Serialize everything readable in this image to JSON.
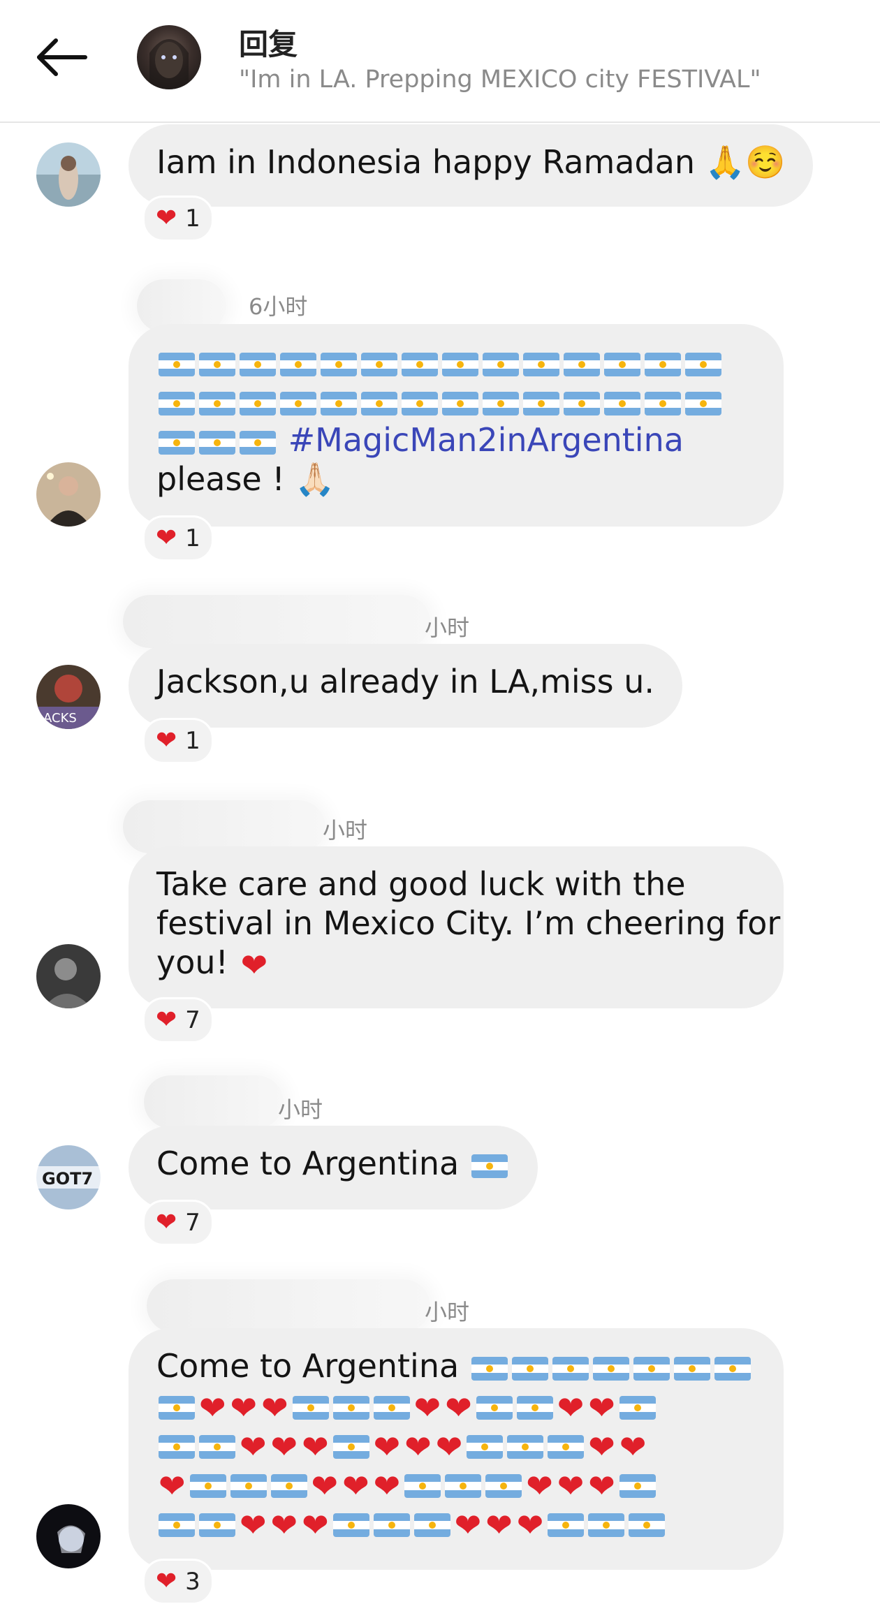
{
  "header": {
    "title": "回复",
    "subtitle": "\"Im in LA. Prepping MEXICO city FESTIVAL\"",
    "back_icon": "arrow-left-icon"
  },
  "comments": [
    {
      "time": "",
      "text": "Iam in Indonesia happy Ramadan 🙏☺️",
      "likes": "1"
    },
    {
      "time": "6小时",
      "flag_row_1": 14,
      "flag_row_2": 14,
      "flag_row_3": 3,
      "hashtag": "#MagicMan2inArgentina",
      "tail": "please ! 🙏🏻",
      "likes": "1"
    },
    {
      "time": "小时",
      "text": "Jackson,u already in LA,miss u.",
      "likes": "1"
    },
    {
      "time": "小时",
      "line1": "Take care and good luck with the",
      "line2": "festival in Mexico City. I’m cheering for",
      "line3": "you!",
      "likes": "7"
    },
    {
      "time": "小时",
      "text": "Come to Argentina",
      "likes": "7"
    },
    {
      "time": "小时",
      "text": "Come to Argentina",
      "emoji_rows": [
        "FFFFFFF",
        "FHHHFFFHHFFHHF",
        "FFHHHFHHHFFFHH",
        "HFFFHHHFFFHHHF",
        "FFHHHFFFHHHFFF"
      ],
      "likes": "3"
    }
  ],
  "colors": {
    "bubble": "#efefef",
    "hashtag": "#3a46b8",
    "heart": "#e0202a",
    "meta": "#8a8a8a"
  }
}
